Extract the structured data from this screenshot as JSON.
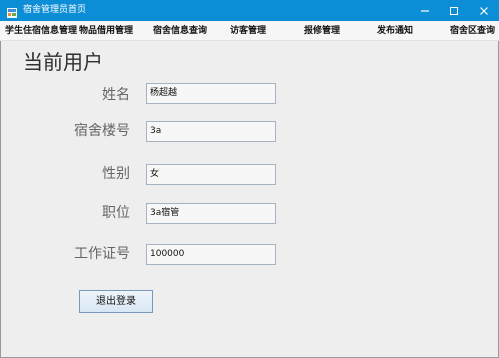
{
  "window": {
    "title": "宿舍管理员首页"
  },
  "menu": {
    "items": [
      "学生住宿信息管理",
      "物品借用管理",
      "宿舍信息查询",
      "访客管理",
      "报修管理",
      "发布通知",
      "宿舍区查询"
    ]
  },
  "page": {
    "heading": "当前用户",
    "fields": [
      {
        "label": "姓名",
        "value": "杨超越"
      },
      {
        "label": "宿舍楼号",
        "value": "3a"
      },
      {
        "label": "性别",
        "value": "女"
      },
      {
        "label": "职位",
        "value": "3a宿管"
      },
      {
        "label": "工作证号",
        "value": "100000"
      }
    ],
    "logout_label": "退出登录"
  },
  "colors": {
    "titlebar": "#0c8ed7",
    "window_background": "#eeeeee",
    "field_border": "#a8b3c2",
    "button_border": "#7a99ba"
  },
  "icons": {
    "app": "java-app-icon",
    "minimize": "minimize-icon",
    "maximize": "maximize-icon",
    "close": "close-icon"
  }
}
